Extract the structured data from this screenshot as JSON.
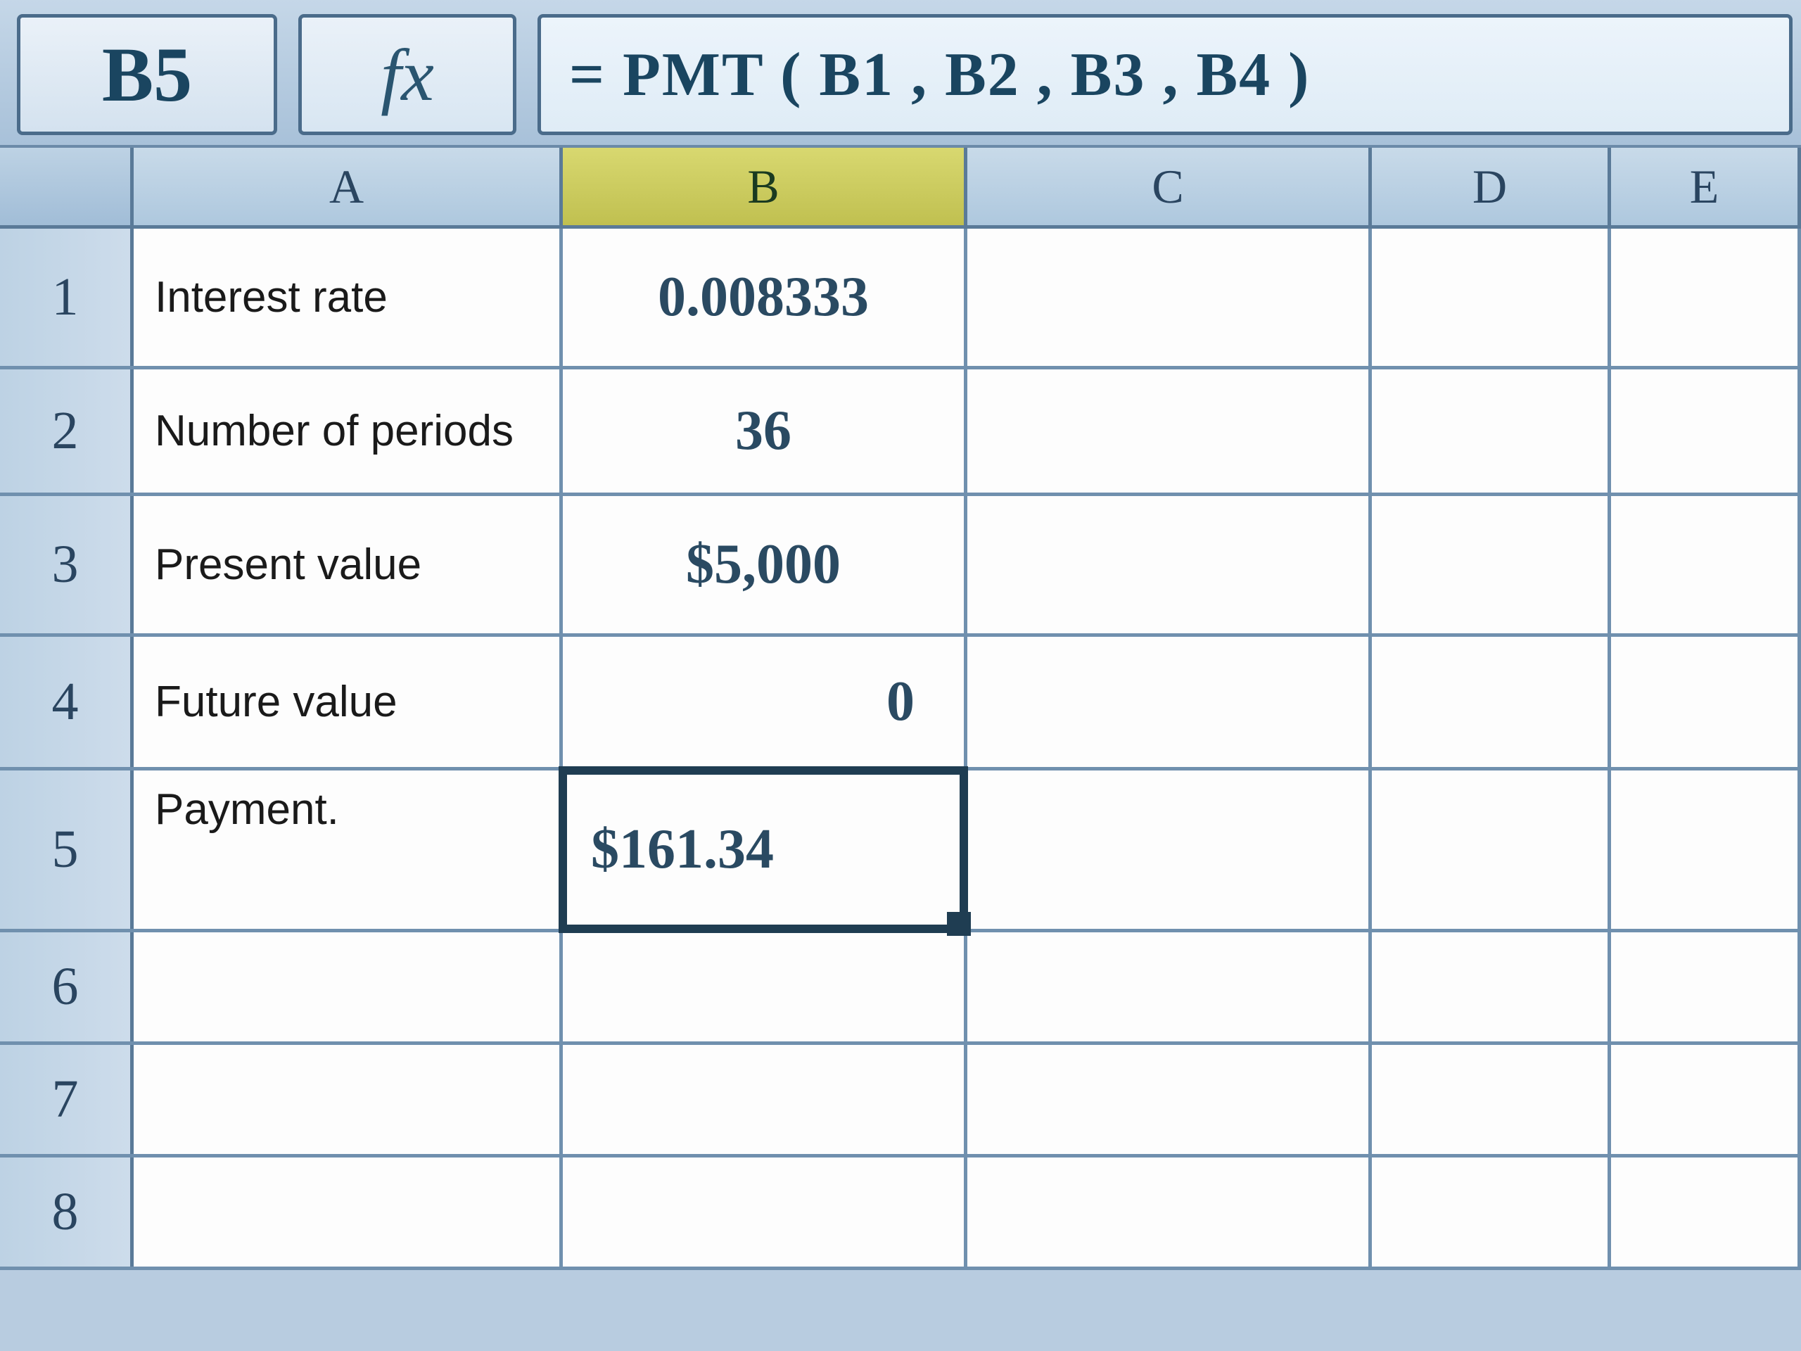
{
  "formula_bar": {
    "name_box": "B5",
    "fx_label": "fx",
    "formula": "= PMT ( B1 , B2 , B3 , B4 )"
  },
  "columns": {
    "A": "A",
    "B": "B",
    "C": "C",
    "D": "D",
    "E": "E"
  },
  "selected_column": "B",
  "selected_cell": "B5",
  "rows": [
    {
      "num": "1",
      "A": "Interest rate",
      "B": "0.008333"
    },
    {
      "num": "2",
      "A": "Number of periods",
      "B": "36"
    },
    {
      "num": "3",
      "A": "Present value",
      "B": "$5,000"
    },
    {
      "num": "4",
      "A": "Future value",
      "B": "0"
    },
    {
      "num": "5",
      "A": "Payment.",
      "B": "$161.34"
    },
    {
      "num": "6",
      "A": "",
      "B": ""
    },
    {
      "num": "7",
      "A": "",
      "B": ""
    },
    {
      "num": "8",
      "A": "",
      "B": ""
    }
  ]
}
